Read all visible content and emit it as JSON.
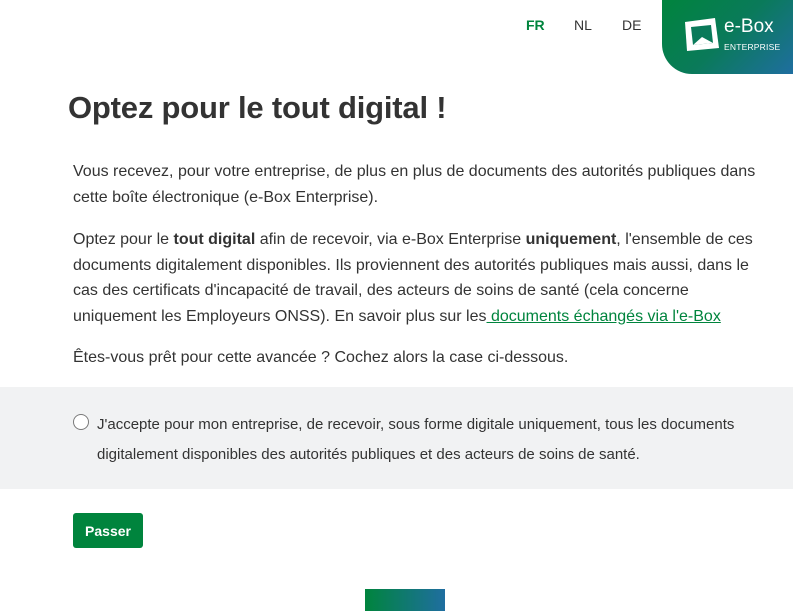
{
  "languages": [
    {
      "code": "FR",
      "active": true
    },
    {
      "code": "NL",
      "active": false
    },
    {
      "code": "DE",
      "active": false
    }
  ],
  "logo": {
    "text": "e-Box",
    "subtext": "ENTERPRISE",
    "color_from": "#00843d",
    "color_to": "#1f6ea0"
  },
  "title": "Optez pour le tout digital !",
  "intro": {
    "p1": "Vous recevez, pour votre entreprise, de plus en plus de documents des autorités publiques dans cette boîte électronique (e-Box Enterprise).",
    "p2_a": "Optez pour le ",
    "p2_b": "tout digital",
    "p2_c": " afin de recevoir, via e-Box Enterprise ",
    "p2_d": "uniquement",
    "p2_e": ", l'ensemble de ces documents digitalement disponibles. Ils proviennent des autorités publiques mais aussi, dans le cas des certificats d'incapacité de travail, des acteurs de soins de santé (cela concerne uniquement les Employeurs ONSS). En savoir plus sur les",
    "link": " documents échangés via l'e-Box",
    "p3": "Êtes-vous prêt pour cette avancée ? Cochez alors la case ci-dessous."
  },
  "consent": {
    "text": "J'accepte pour mon entreprise, de recevoir, sous forme digitale uniquement, tous les documents digitalement disponibles des autorités publiques et des acteurs de soins de santé.",
    "checked": false
  },
  "actions": {
    "passer_label": "Passer"
  },
  "colors": {
    "accent": "#00843d",
    "consent_bg": "#f1f2f3",
    "text": "#333333"
  }
}
